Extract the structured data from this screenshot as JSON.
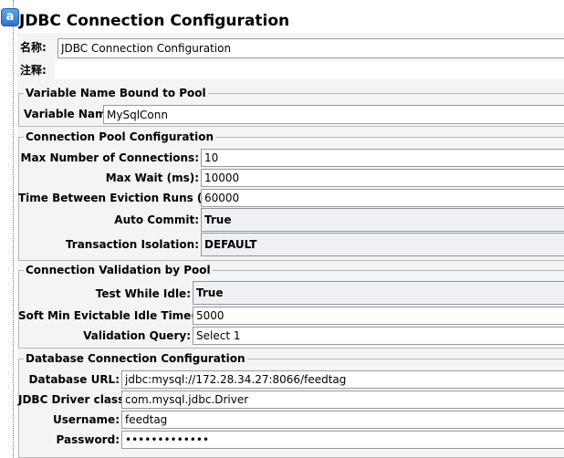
{
  "app": {
    "badge": "a"
  },
  "title": "JDBC Connection Configuration",
  "name_row": {
    "label": "名称:",
    "value": "JDBC Connection Configuration"
  },
  "comment_row": {
    "label": "注释:",
    "value": ""
  },
  "section_pool_var": {
    "legend": "Variable Name Bound to Pool",
    "variable_name": {
      "label": "Variable Name:",
      "value": "MySqlConn"
    }
  },
  "section_pool_config": {
    "legend": "Connection Pool Configuration",
    "max_connections": {
      "label": "Max Number of Connections:",
      "value": "10"
    },
    "max_wait": {
      "label": "Max Wait (ms):",
      "value": "10000"
    },
    "eviction_runs": {
      "label": "Time Between Eviction Runs (ms):",
      "value": "60000"
    },
    "auto_commit": {
      "label": "Auto Commit:",
      "value": "True"
    },
    "transaction_isolation": {
      "label": "Transaction Isolation:",
      "value": "DEFAULT"
    }
  },
  "section_validation": {
    "legend": "Connection Validation by Pool",
    "test_while_idle": {
      "label": "Test While Idle:",
      "value": "True"
    },
    "soft_min_idle": {
      "label": "Soft Min Evictable Idle Time(ms):",
      "value": "5000"
    },
    "validation_query": {
      "label": "Validation Query:",
      "value": "Select 1"
    }
  },
  "section_database": {
    "legend": "Database Connection Configuration",
    "url": {
      "label": "Database URL:",
      "value": "jdbc:mysql://172.28.34.27:8066/feedtag"
    },
    "driver": {
      "label": "JDBC Driver class:",
      "value": "com.mysql.jdbc.Driver"
    },
    "username": {
      "label": "Username:",
      "value": "feedtag"
    },
    "password": {
      "label": "Password:",
      "value": "•••••••••••••"
    }
  }
}
